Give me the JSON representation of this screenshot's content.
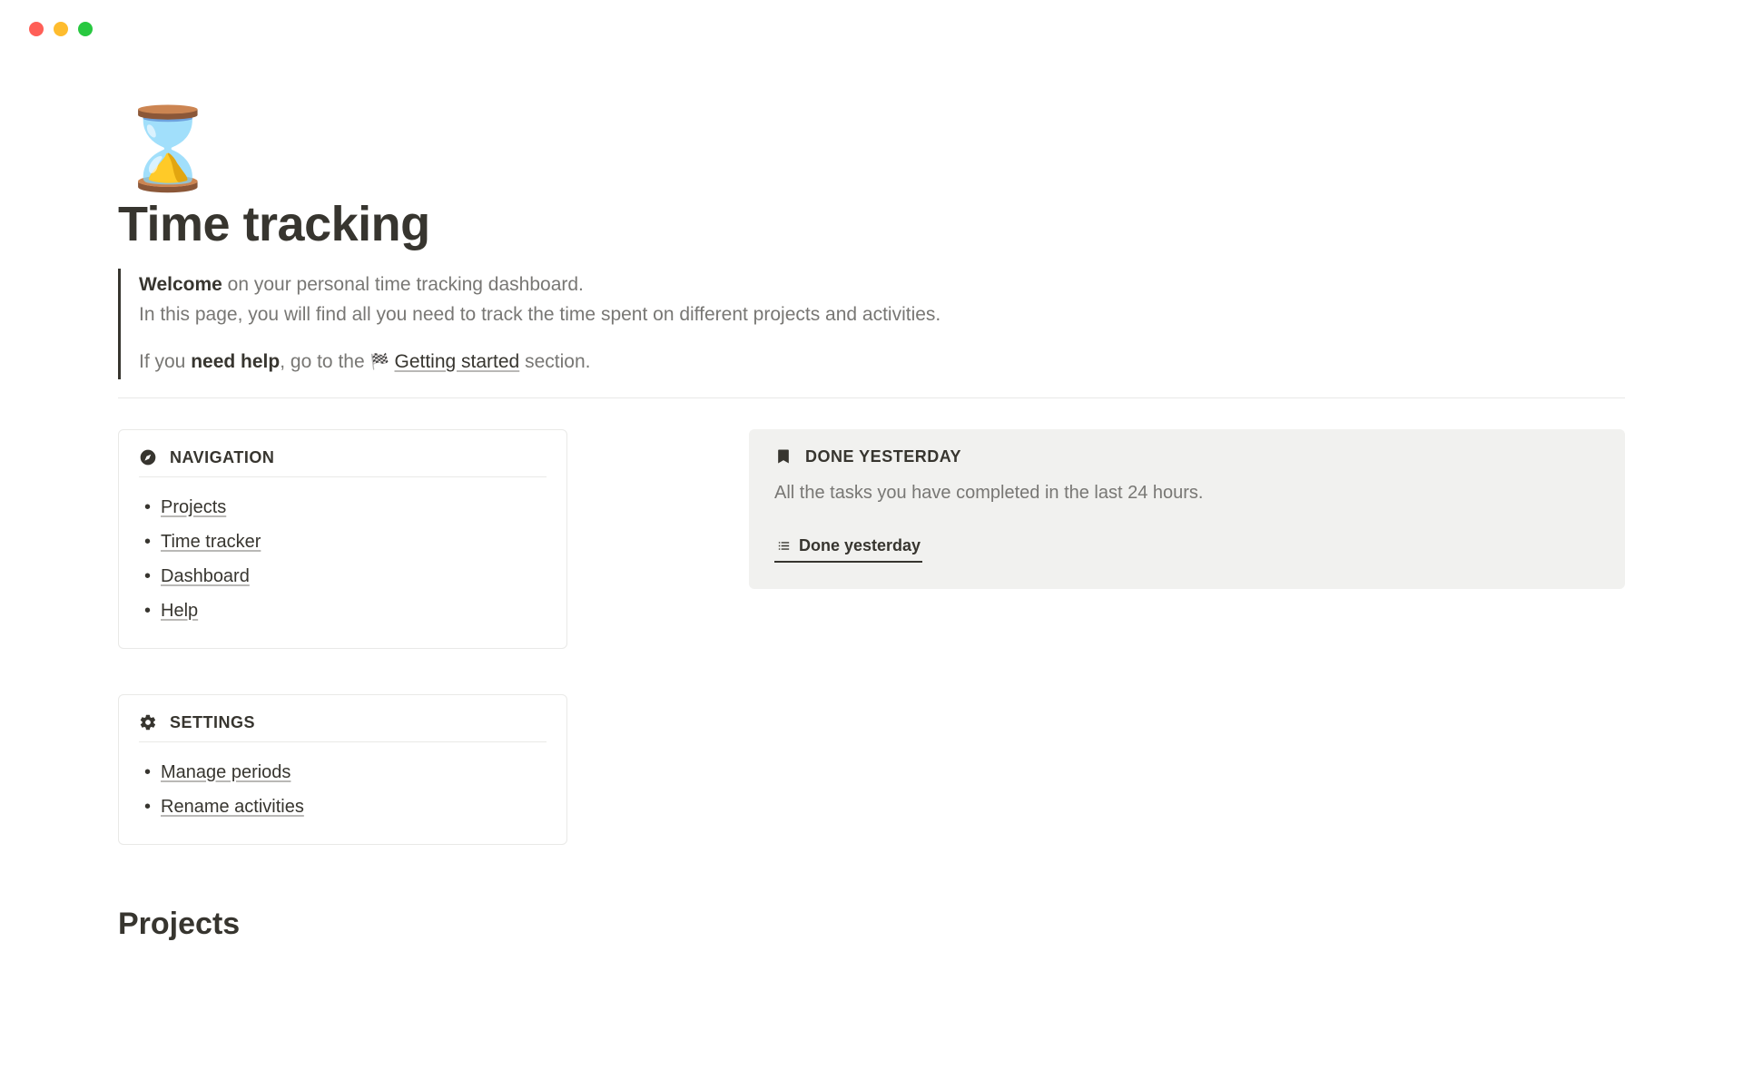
{
  "window": {
    "traffic_light_colors": {
      "red": "#ff5f57",
      "yellow": "#febc2e",
      "green": "#28c840"
    }
  },
  "page": {
    "icon": "⌛",
    "title": "Time tracking"
  },
  "intro": {
    "welcome_strong": "Welcome",
    "welcome_rest": " on your personal time tracking dashboard.",
    "line2": "In this page, you will find all you need to track the time spent on different projects and activities.",
    "help_prefix": "If you ",
    "help_strong": "need help",
    "help_mid": ", go to the ",
    "help_link_icon": "🏁",
    "help_link_text": "Getting started",
    "help_suffix": " section."
  },
  "navigation": {
    "heading": "NAVIGATION",
    "items": [
      {
        "label": "Projects"
      },
      {
        "label": "Time tracker"
      },
      {
        "label": "Dashboard"
      },
      {
        "label": "Help"
      }
    ]
  },
  "settings": {
    "heading": "SETTINGS",
    "items": [
      {
        "label": "Manage periods"
      },
      {
        "label": "Rename activities"
      }
    ]
  },
  "done_yesterday": {
    "heading": "DONE YESTERDAY",
    "subtext": "All the tasks you have completed in the last 24 hours.",
    "tab_label": "Done yesterday"
  },
  "sections": {
    "projects_heading": "Projects"
  }
}
